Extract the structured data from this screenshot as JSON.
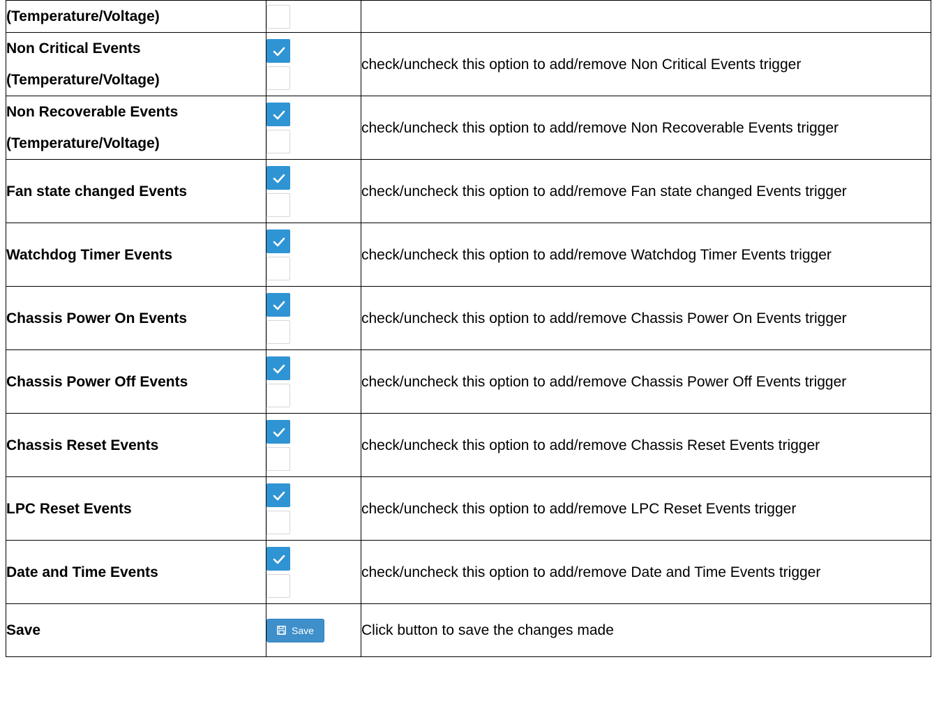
{
  "rows": [
    {
      "name_lines": [
        "(Temperature/Voltage)"
      ],
      "checkboxes": [
        false
      ],
      "description": ""
    },
    {
      "name_lines": [
        "Non Critical Events",
        "(Temperature/Voltage)"
      ],
      "checkboxes": [
        true,
        false
      ],
      "description": "check/uncheck this option to add/remove Non Critical Events trigger"
    },
    {
      "name_lines": [
        "Non Recoverable Events",
        "(Temperature/Voltage)"
      ],
      "checkboxes": [
        true,
        false
      ],
      "description": "check/uncheck this option to add/remove Non Recoverable Events trigger"
    },
    {
      "name_lines": [
        "Fan state changed Events"
      ],
      "checkboxes": [
        true,
        false
      ],
      "description": "check/uncheck this option to add/remove Fan state changed Events trigger"
    },
    {
      "name_lines": [
        "Watchdog Timer Events"
      ],
      "checkboxes": [
        true,
        false
      ],
      "description": "check/uncheck this option to add/remove Watchdog Timer Events trigger"
    },
    {
      "name_lines": [
        "Chassis Power On Events"
      ],
      "checkboxes": [
        true,
        false
      ],
      "description": "check/uncheck this option to add/remove Chassis Power On Events trigger"
    },
    {
      "name_lines": [
        "Chassis Power Off Events"
      ],
      "checkboxes": [
        true,
        false
      ],
      "description": "check/uncheck this option to add/remove Chassis Power Off Events trigger"
    },
    {
      "name_lines": [
        "Chassis Reset Events"
      ],
      "checkboxes": [
        true,
        false
      ],
      "description": "check/uncheck this option to add/remove Chassis Reset Events trigger"
    },
    {
      "name_lines": [
        "LPC Reset Events"
      ],
      "checkboxes": [
        true,
        false
      ],
      "description": "check/uncheck this option to add/remove LPC Reset Events trigger"
    },
    {
      "name_lines": [
        "Date and Time Events"
      ],
      "checkboxes": [
        true,
        false
      ],
      "description": "check/uncheck this option to add/remove Date and Time Events trigger"
    }
  ],
  "save_row": {
    "name": "Save",
    "button_label": "Save",
    "button_icon": "floppy-disk-icon",
    "description": "Click button to save the changes made"
  },
  "colors": {
    "checkbox_checked": "#2f94d3",
    "checkbox_border": "#d6d6d6",
    "button": "#3f8fcb"
  }
}
